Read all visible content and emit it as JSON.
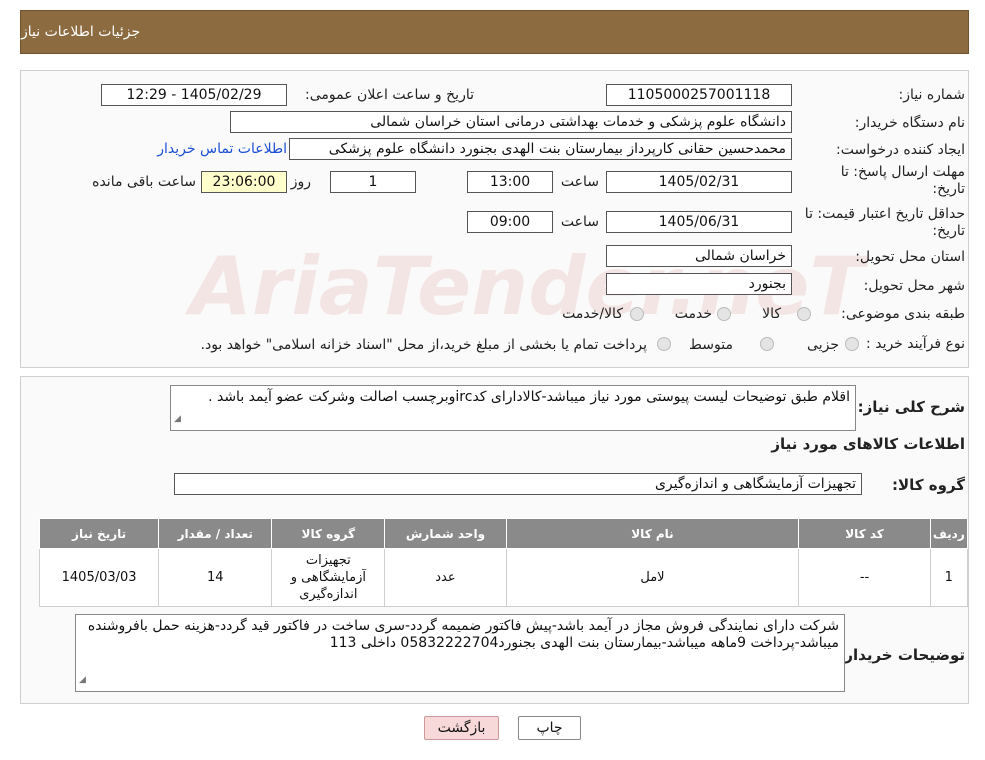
{
  "header": {
    "title": "جزئیات اطلاعات نیاز"
  },
  "watermark": "AriaTender.neT",
  "fields": {
    "need_number_label": "شماره نیاز:",
    "need_number": "1105000257001118",
    "announce_label": "تاریخ و ساعت اعلان عمومی:",
    "announce_value": "1405/02/29 - 12:29",
    "buyer_org_label": "نام دستگاه خریدار:",
    "buyer_org": "دانشگاه علوم پزشکی و خدمات بهداشتی درمانی استان خراسان شمالی",
    "creator_label": "ایجاد کننده درخواست:",
    "creator": "محمدحسین حقانی کارپرداز بیمارستان بنت الهدی بجنورد دانشگاه علوم پزشکی",
    "contact_link": "اطلاعات تماس خریدار",
    "deadline_label": "مهلت ارسال پاسخ: تا تاریخ:",
    "deadline_date": "1405/02/31",
    "time_label": "ساعت",
    "deadline_time": "13:00",
    "days_value": "1",
    "days_label": "روز و",
    "remaining_time": "23:06:00",
    "remaining_label": "ساعت باقی مانده",
    "validity_label": "حداقل تاریخ اعتبار قیمت: تا تاریخ:",
    "validity_date": "1405/06/31",
    "validity_time": "09:00",
    "province_label": "استان محل تحویل:",
    "province": "خراسان شمالی",
    "city_label": "شهر محل تحویل:",
    "city": "بجنورد",
    "category_label": "طبقه بندی موضوعی:",
    "category_options": [
      "کالا",
      "خدمت",
      "کالا/خدمت"
    ],
    "process_label": "نوع فرآیند خرید :",
    "process_options": [
      "جزیی",
      "متوسط"
    ],
    "process_note": "پرداخت تمام یا بخشی از مبلغ خرید،از محل \"اسناد خزانه اسلامی\" خواهد بود."
  },
  "description": {
    "label": "شرح کلی نیاز:",
    "text": "اقلام طبق توضیحات لیست پیوستی مورد نیاز میباشد-کالادارای کدircوبرچسب اصالت وشرکت عضو آیمد باشد ."
  },
  "items_section": {
    "title": "اطلاعات کالاهای مورد نیاز",
    "group_label": "گروه کالا:",
    "group_value": "تجهیزات آزمایشگاهی و اندازه‌گیری"
  },
  "table": {
    "headers": [
      "ردیف",
      "کد کالا",
      "نام کالا",
      "واحد شمارش",
      "گروه کالا",
      "تعداد / مقدار",
      "تاریخ نیاز"
    ],
    "rows": [
      [
        "1",
        "--",
        "لامل",
        "عدد",
        "تجهیزات آزمایشگاهی و اندازه‌گیری",
        "14",
        "1405/03/03"
      ]
    ]
  },
  "buyer_notes": {
    "label": "توضیحات خریدار:",
    "text": "شرکت دارای نمایندگی فروش مجاز در آیمد باشد-پیش فاکتور ضمیمه گردد-سری ساخت در فاکتور قید گردد-هزینه حمل بافروشنده میباشد-پرداخت 9ماهه میباشد-بیمارستان بنت الهدی بجنورد05832222704 داخلی 113"
  },
  "buttons": {
    "print": "چاپ",
    "back": "بازگشت"
  },
  "colors": {
    "header_bg": "#8b6b3f",
    "table_header_bg": "#8a8a8a",
    "back_button_bg": "#f7d9d9",
    "remaining_bg": "#ffffcc",
    "link": "#1a4fd6"
  }
}
